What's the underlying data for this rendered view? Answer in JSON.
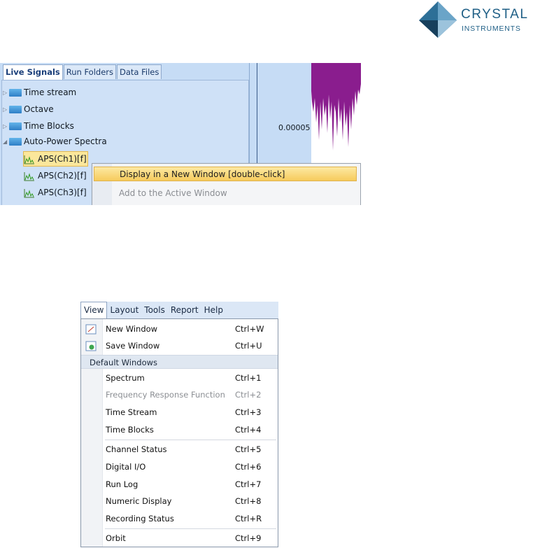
{
  "logo": {
    "line1": "CRYSTAL",
    "line2": "INSTRUMENTS",
    "brand_color": "#1f5f86"
  },
  "explorer": {
    "tabs": [
      {
        "label": "Live Signals",
        "active": true
      },
      {
        "label": "Run Folders",
        "active": false
      },
      {
        "label": "Data Files",
        "active": false
      }
    ],
    "tree": [
      {
        "label": "Time stream",
        "expanded": false
      },
      {
        "label": "Octave",
        "expanded": false
      },
      {
        "label": "Time Blocks",
        "expanded": false
      },
      {
        "label": "Auto-Power Spectra",
        "expanded": true,
        "children": [
          {
            "label": "APS(Ch1)[f]",
            "selected": true
          },
          {
            "label": "APS(Ch2)[f]",
            "selected": false
          },
          {
            "label": "APS(Ch3)[f]",
            "selected": false
          }
        ]
      }
    ],
    "y_value": "0.00005",
    "context_menu": [
      {
        "label": "Display in a New Window [double-click]",
        "highlighted": true,
        "disabled": false
      },
      {
        "label": "Add to the Active Window",
        "highlighted": false,
        "disabled": true
      }
    ]
  },
  "menubar": {
    "items": [
      "View",
      "Layout",
      "Tools",
      "Report",
      "Help"
    ],
    "open_item": "View"
  },
  "view_menu": {
    "top_items": [
      {
        "label": "New Window",
        "shortcut": "Ctrl+W",
        "icon": "new-window-icon"
      },
      {
        "label": "Save Window",
        "shortcut": "Ctrl+U",
        "icon": "save-window-icon"
      }
    ],
    "group_header": "Default Windows",
    "group1": [
      {
        "label": "Spectrum",
        "shortcut": "Ctrl+1",
        "disabled": false
      },
      {
        "label": "Frequency Response Function",
        "shortcut": "Ctrl+2",
        "disabled": true
      },
      {
        "label": "Time Stream",
        "shortcut": "Ctrl+3",
        "disabled": false
      },
      {
        "label": "Time Blocks",
        "shortcut": "Ctrl+4",
        "disabled": false
      }
    ],
    "group2": [
      {
        "label": "Channel Status",
        "shortcut": "Ctrl+5",
        "disabled": false
      },
      {
        "label": "Digital I/O",
        "shortcut": "Ctrl+6",
        "disabled": false
      },
      {
        "label": "Run Log",
        "shortcut": "Ctrl+7",
        "disabled": false
      },
      {
        "label": "Numeric Display",
        "shortcut": "Ctrl+8",
        "disabled": false
      },
      {
        "label": "Recording Status",
        "shortcut": "Ctrl+R",
        "disabled": false
      }
    ],
    "group3": [
      {
        "label": "Orbit",
        "shortcut": "Ctrl+9",
        "disabled": false
      }
    ]
  }
}
